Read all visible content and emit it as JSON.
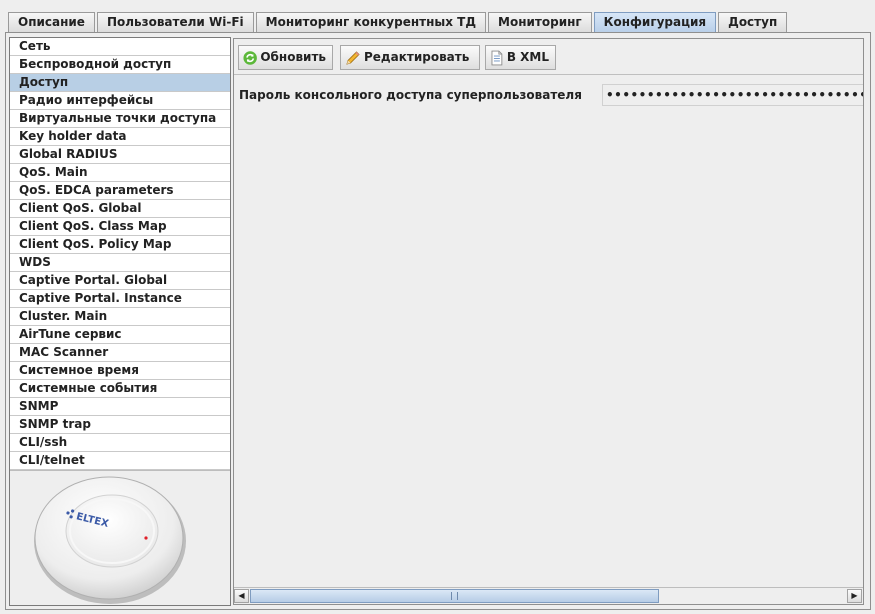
{
  "tabs": [
    {
      "label": "Описание"
    },
    {
      "label": "Пользователи Wi-Fi"
    },
    {
      "label": "Мониторинг конкурентных ТД"
    },
    {
      "label": "Мониторинг"
    },
    {
      "label": "Конфигурация",
      "active": true
    },
    {
      "label": "Доступ"
    }
  ],
  "sidebar": {
    "selected": "Доступ",
    "items": [
      {
        "label": "Сеть"
      },
      {
        "label": "Беспроводной доступ"
      },
      {
        "label": "Доступ"
      },
      {
        "label": "Радио интерфейсы"
      },
      {
        "label": "Виртуальные точки доступа"
      },
      {
        "label": "Key holder data"
      },
      {
        "label": "Global RADIUS"
      },
      {
        "label": "QoS. Main"
      },
      {
        "label": "QoS. EDCA parameters"
      },
      {
        "label": "Client QoS. Global"
      },
      {
        "label": "Client QoS. Class Map"
      },
      {
        "label": "Client QoS. Policy Map"
      },
      {
        "label": "WDS"
      },
      {
        "label": "Captive Portal. Global"
      },
      {
        "label": "Captive Portal. Instance"
      },
      {
        "label": "Cluster. Main"
      },
      {
        "label": "AirTune сервис"
      },
      {
        "label": "MAC Scanner"
      },
      {
        "label": "Системное время"
      },
      {
        "label": "Системные события"
      },
      {
        "label": "SNMP"
      },
      {
        "label": "SNMP trap"
      },
      {
        "label": "CLI/ssh"
      },
      {
        "label": "CLI/telnet"
      }
    ],
    "device": {
      "brand": "ELTEX",
      "icon": "access-point-device-image",
      "led_color": "#e0202a"
    }
  },
  "toolbar": {
    "refresh_label": "Обновить",
    "edit_label": "Редактировать",
    "xml_label": "В XML"
  },
  "form": {
    "superuser_password_label": "Пароль консольного доступа суперпользователя",
    "superuser_password_value": "••••••••••••••••••••••••••••••••••••••••"
  },
  "colors": {
    "selection": "#b8cfe5",
    "active_tab": "#c7daf0",
    "refresh_icon": "#3a9a2a",
    "edit_icon": "#e0a020"
  }
}
